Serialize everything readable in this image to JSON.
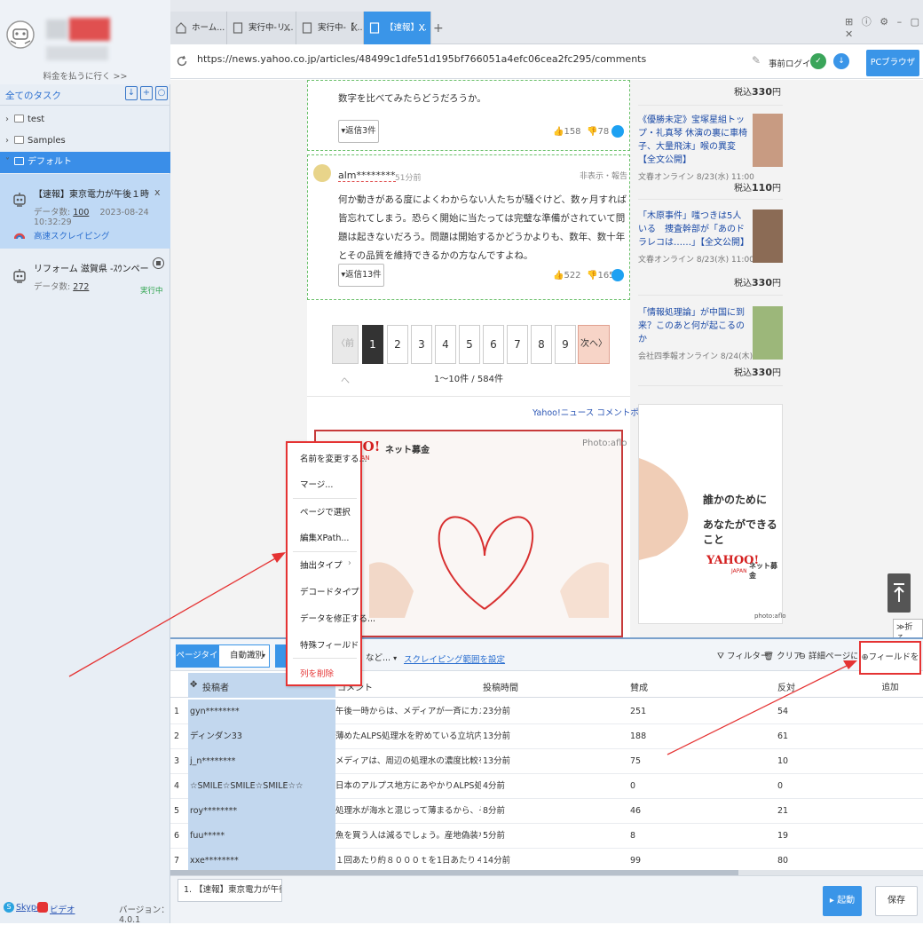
{
  "sidebar": {
    "pay_link": "料金を払うに行く >>",
    "all_tasks": "全てのタスク",
    "tree": [
      {
        "label": "test"
      },
      {
        "label": "Samples"
      },
      {
        "label": "デフォルト"
      }
    ],
    "tasks": [
      {
        "title": "【速報】東京電力が午後１時頃から福島第...",
        "count_label": "データ数:",
        "count": "100",
        "time": "2023-08-24 10:32:29",
        "mode": "高速スクレイピング"
      },
      {
        "title": "リフォーム 滋賀県 -ｽｳンペーシ-スクレ...",
        "count_label": "データ数:",
        "count": "272",
        "status": "実行中"
      }
    ],
    "skype": "Skype",
    "video": "ビデオ",
    "version": "バージョン：4.0.1"
  },
  "tabs": [
    {
      "label": "ホーム..."
    },
    {
      "label": "実行中-リ..."
    },
    {
      "label": "実行中-【..."
    },
    {
      "label": "【速報】..."
    }
  ],
  "address": {
    "url": "https://news.yahoo.co.jp/articles/48499c1dfe51d195bf766051a4efc06cea2fc295/comments",
    "pre_login": "事前ログイン",
    "pc_browser": "PCブラウザ"
  },
  "comments": [
    {
      "text": "数字を比べてみたらどうだろうか。",
      "reply": "返信3件",
      "likes": "158",
      "dislikes": "78"
    },
    {
      "user": "alm********",
      "time": "51分前",
      "hide": "非表示・報告",
      "text": "何か動きがある度によくわからない人たちが騒ぐけど、数ヶ月すれば皆忘れてしまう。恐らく開始に当たっては完璧な準備がされていて問題は起きないだろう。問題は開始するかどうかよりも、数年、数十年とその品質を維持できるかの方なんですよね。",
      "reply": "返信13件",
      "likes": "522",
      "dislikes": "165"
    }
  ],
  "pagination": {
    "prev": "〈前へ",
    "pages": [
      "1",
      "2",
      "3",
      "4",
      "5",
      "6",
      "7",
      "8",
      "9"
    ],
    "next": "次へ〉",
    "count": "1〜10件 / 584件"
  },
  "policy": "Yahoo!ニュース コメントポリシー",
  "donation": {
    "logo": "YAHOO!",
    "logo_sub": "JAPAN",
    "label": "ネット募金",
    "credit": "Photo:aflo"
  },
  "right_news": [
    {
      "price": "330"
    },
    {
      "title": "《優勝未定》宝塚星組トップ・礼真琴 休演の裏に車椅子、大量飛沫」喉の異変【全文公開】",
      "source": "文春オンライン 8/23(水) 11:00",
      "price": "110"
    },
    {
      "title": "「木原事件」嗤つきは5人いる　捜査幹部が「あのドラレコは……」【全文公開】",
      "source": "文春オンライン 8/23(水) 11:00",
      "price": "330"
    },
    {
      "title": "「情報処理論」が中国に到来？このあと何が起こるのか",
      "source": "会社四季報オンライン 8/24(木) 7:02",
      "price": "330"
    }
  ],
  "price_prefix": "税込",
  "price_suffix": "円",
  "ad": {
    "line1": "誰かのために",
    "line2": "あなたができること",
    "logo": "YAHOO!",
    "logo_sub": "JAPAN",
    "label": "ネット募金",
    "credit": "photo:aflo"
  },
  "fold": "≫折る",
  "toolbar": {
    "page_type": "ページタイプ",
    "auto_detect": "自動識別",
    "load_mode": "など...",
    "scrape_range": "スクレイピング範囲を設定",
    "filter": "フィルター",
    "clear": "クリア",
    "detail": "詳細ページに行く",
    "add_field": "フィールドを追加"
  },
  "context_menu": [
    {
      "label": "名前を変更する..."
    },
    {
      "label": "マージ..."
    },
    {
      "label": "ページで選択"
    },
    {
      "label": "編集XPath..."
    },
    {
      "label": "抽出タイプ"
    },
    {
      "label": "デコードタイプ"
    },
    {
      "label": "データを修正する..."
    },
    {
      "label": "特殊フィールド"
    },
    {
      "label": "列を削除"
    }
  ],
  "table": {
    "headers": [
      "投稿者",
      "コメント",
      "投稿時間",
      "賛成",
      "反対"
    ],
    "rows": [
      [
        "1",
        "gyn********",
        "午後一時からは、メディアが一斉にカメラを入れて...",
        "23分前",
        "251",
        "54"
      ],
      [
        "2",
        "ディンダン33",
        "薄めたALPS処理水を貯めている立坑内のトリチウ...",
        "13分前",
        "188",
        "61"
      ],
      [
        "3",
        "j_n********",
        "メディアは、周辺の処理水の濃度比較を合わせ科学...",
        "13分前",
        "75",
        "10"
      ],
      [
        "4",
        "☆SMILE☆SMILE☆SMILE☆☆",
        "日本のアルプス地方にあやかりALPS処理水という...",
        "4分前",
        "0",
        "0"
      ],
      [
        "5",
        "roy********",
        "処理水が海水と混じって薄まるから、そこまで気に...",
        "8分前",
        "46",
        "21"
      ],
      [
        "6",
        "fuu*****",
        "魚を買う人は減るでしょう。産地偽装なども考えれ...",
        "5分前",
        "8",
        "19"
      ],
      [
        "7",
        "xxe********",
        "１回あたり約８０００ｔを1日あたり４６０ｔを数...",
        "14分前",
        "99",
        "80"
      ]
    ]
  },
  "bottom": {
    "task_tab": "1. 【速報】東京電力が午後１時頃...",
    "start": "起動",
    "save": "保存"
  },
  "colors": {
    "accent": "#3a95e8",
    "highlight": "#e53333",
    "selected_column": "#c2d7ee"
  }
}
